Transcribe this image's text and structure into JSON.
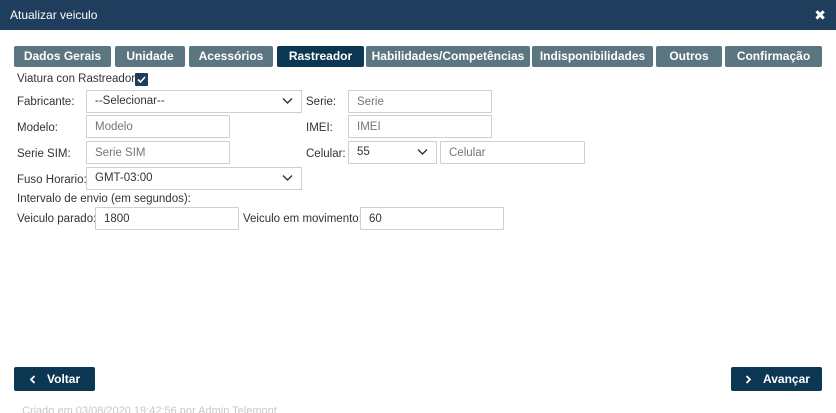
{
  "window": {
    "title": "Atualizar veiculo",
    "close_symbol": "✖"
  },
  "tabs": [
    {
      "label": "Dados Gerais",
      "active": false
    },
    {
      "label": "Unidade",
      "active": false
    },
    {
      "label": "Acessórios",
      "active": false
    },
    {
      "label": "Rastreador",
      "active": true
    },
    {
      "label": "Habilidades/Competências",
      "active": false
    },
    {
      "label": "Indisponibilidades",
      "active": false
    },
    {
      "label": "Outros",
      "active": false
    },
    {
      "label": "Confirmação",
      "active": false
    }
  ],
  "form": {
    "tracker_label": "Viatura con Rastreador:",
    "tracker_checked": true,
    "manufacturer_label": "Fabricante:",
    "manufacturer_value": "--Selecionar--",
    "serie_label": "Serie:",
    "serie_placeholder": "Serie",
    "model_label": "Modelo:",
    "model_placeholder": "Modelo",
    "imei_label": "IMEI:",
    "imei_placeholder": "IMEI",
    "sim_label": "Serie SIM:",
    "sim_placeholder": "Serie SIM",
    "cell_label": "Celular:",
    "cell_code_value": "55",
    "cell_placeholder": "Celular",
    "timezone_label": "Fuso Horario:",
    "timezone_value": "GMT-03:00",
    "interval_label": "Intervalo de envio (em segundos):",
    "stopped_label": "Veiculo parado:",
    "stopped_value": "1800",
    "moving_label": "Veiculo em movimento:",
    "moving_value": "60"
  },
  "buttons": {
    "back_label": "Voltar",
    "next_label": "Avançar"
  },
  "footer": {
    "created_text": "Criado em 03/08/2020 19:42:56 por Admin Telemont"
  },
  "colors": {
    "titlebar": "#1f3d5c",
    "tab": "#5b7581",
    "tab_active": "#0c3753",
    "button": "#0c3753"
  }
}
